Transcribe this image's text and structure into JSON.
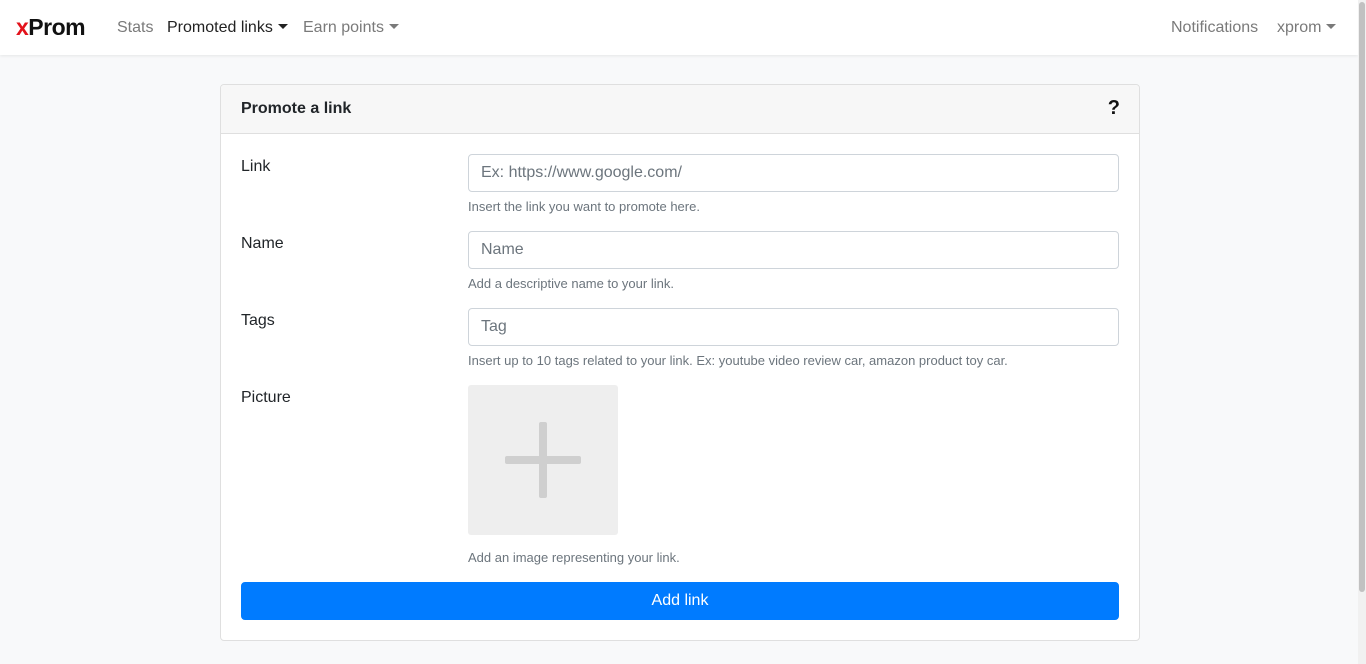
{
  "nav": {
    "brand_x": "x",
    "brand_rest": "Prom",
    "stats": "Stats",
    "promoted_links": "Promoted links",
    "earn_points": "Earn points",
    "notifications": "Notifications",
    "user": "xprom"
  },
  "card": {
    "title": "Promote a link",
    "help": "?"
  },
  "form": {
    "link": {
      "label": "Link",
      "value": "",
      "placeholder": "Ex: https://www.google.com/",
      "help": "Insert the link you want to promote here."
    },
    "name": {
      "label": "Name",
      "value": "",
      "placeholder": "Name",
      "help": "Add a descriptive name to your link."
    },
    "tags": {
      "label": "Tags",
      "value": "",
      "placeholder": "Tag",
      "help": "Insert up to 10 tags related to your link. Ex: youtube video review car, amazon product toy car."
    },
    "picture": {
      "label": "Picture",
      "icon": "plus-icon",
      "help": "Add an image representing your link."
    },
    "submit": "Add link"
  },
  "colors": {
    "brand_x": "#e3121b",
    "primary": "#007bff"
  }
}
